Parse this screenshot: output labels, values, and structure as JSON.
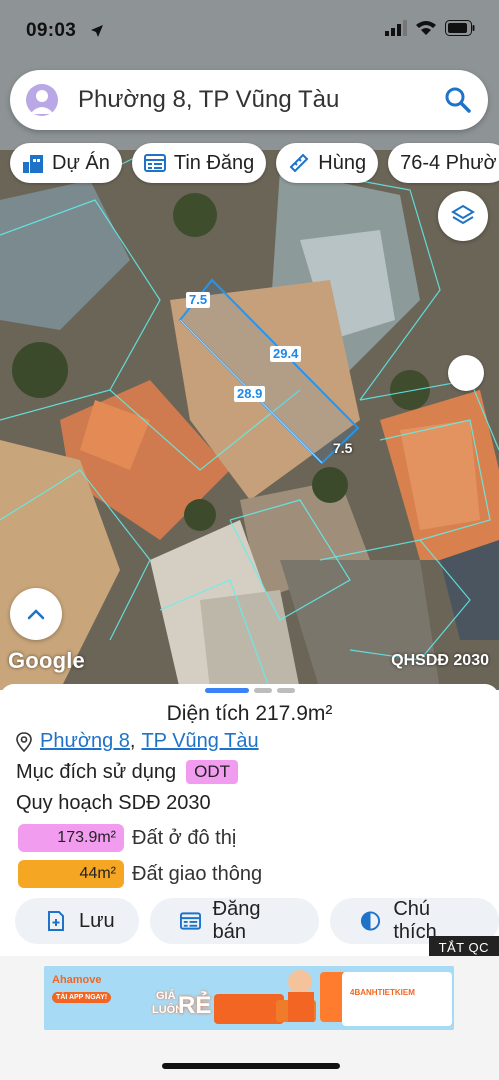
{
  "status": {
    "time": "09:03"
  },
  "search": {
    "text": "Phường 8, TP Vũng Tàu"
  },
  "chips": [
    {
      "label": "Dự Án",
      "icon": "chart-icon"
    },
    {
      "label": "Tin Đăng",
      "icon": "list-icon"
    },
    {
      "label": "Hùng",
      "icon": "ruler-icon"
    },
    {
      "label": "76-4 Phườ",
      "icon": ""
    }
  ],
  "map": {
    "attribution": "Google",
    "plan_label": "QHSDĐ 2030",
    "dimensions": {
      "top": "7.5",
      "right_side": "29.4",
      "left_side": "28.9",
      "bottom": "7.5"
    }
  },
  "sheet": {
    "area_label": "Diện tích",
    "area_value": "217.9m²",
    "ward": "Phường 8",
    "city": "TP Vũng Tàu",
    "purpose_label": "Mục đích sử dụng",
    "purpose_code": "ODT",
    "plan_title": "Quy hoạch SDĐ 2030",
    "land_uses": [
      {
        "area": "173.9m²",
        "label": "Đất ở đô thị",
        "color": "#f29cf0"
      },
      {
        "area": "44m²",
        "label": "Đất giao thông",
        "color": "#f5a623"
      }
    ],
    "actions": [
      {
        "label": "Lưu",
        "icon": "save-icon"
      },
      {
        "label": "Đăng bán",
        "icon": "post-icon"
      },
      {
        "label": "Chú thích",
        "icon": "legend-icon"
      }
    ]
  },
  "ad": {
    "close_label": "TẮT QC",
    "brand": "Ahamove",
    "cta": "TẢI APP NGAY!",
    "slogan_top": "GIÁ",
    "slogan_mid": "LUÔN",
    "slogan_big": "RẺ",
    "partner": "4BANHTIETKIEM"
  },
  "colors": {
    "accent": "#1e88e5",
    "residential": "#f29cf0",
    "traffic": "#f5a623"
  }
}
